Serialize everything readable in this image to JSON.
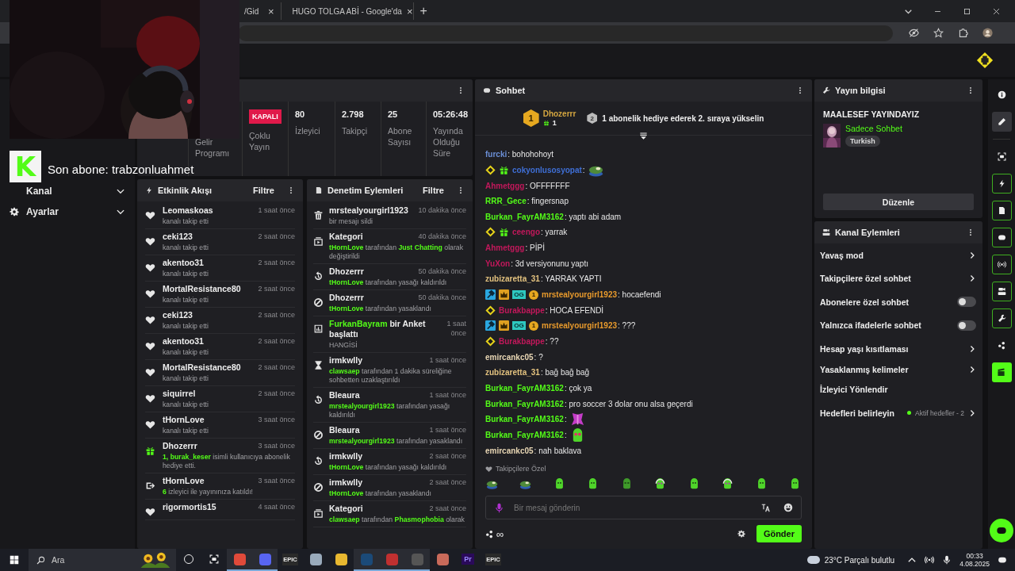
{
  "browser": {
    "tabs": [
      {
        "kind": "page",
        "label": "/Gid",
        "selected": false
      },
      {
        "kind": "search",
        "label": "HUGO TOLGA ABİ - Google'da",
        "selected": false
      }
    ],
    "close_glyph": "×",
    "new_tab_glyph": "+"
  },
  "webcam_overlay": {
    "kind": "picture",
    "logo_letter": "K",
    "text": "Son abone: trabzonluahmet"
  },
  "sidebar": {
    "items": [
      {
        "kind": "plain",
        "label": "Kanal",
        "expanded": false
      },
      {
        "kind": "settings",
        "label": "Ayarlar",
        "expanded": false
      }
    ]
  },
  "stats": [
    {
      "kind": "label",
      "label": "Gelir Programı"
    },
    {
      "kind": "badge",
      "value": "KAPALI",
      "label": "Çoklu Yayın"
    },
    {
      "kind": "number",
      "value": "80",
      "label": "İzleyici"
    },
    {
      "kind": "number",
      "value": "2.798",
      "label": "Takipçi"
    },
    {
      "kind": "number",
      "value": "25",
      "label": "Abone Sayısı"
    },
    {
      "kind": "number",
      "value": "05:26:48",
      "label": "Yayında Olduğu Süre"
    }
  ],
  "activity": {
    "title": "Etkinlik Akışı",
    "filter": "Filtre",
    "items": [
      {
        "kind": "follow",
        "user": "Leomaskoas",
        "time": "1 saat önce",
        "detail": [
          {
            "text": "kanalı takip etti",
            "accent": false
          }
        ]
      },
      {
        "kind": "follow",
        "user": "ceki123",
        "time": "2 saat önce",
        "detail": [
          {
            "text": "kanalı takip etti",
            "accent": false
          }
        ]
      },
      {
        "kind": "follow",
        "user": "akentoo31",
        "time": "2 saat önce",
        "detail": [
          {
            "text": "kanalı takip etti",
            "accent": false
          }
        ]
      },
      {
        "kind": "follow",
        "user": "MortalResistance80",
        "time": "2 saat önce",
        "detail": [
          {
            "text": "kanalı takip etti",
            "accent": false
          }
        ]
      },
      {
        "kind": "follow",
        "user": "ceki123",
        "time": "2 saat önce",
        "detail": [
          {
            "text": "kanalı takip etti",
            "accent": false
          }
        ]
      },
      {
        "kind": "follow",
        "user": "akentoo31",
        "time": "2 saat önce",
        "detail": [
          {
            "text": "kanalı takip etti",
            "accent": false
          }
        ]
      },
      {
        "kind": "follow",
        "user": "MortalResistance80",
        "time": "2 saat önce",
        "detail": [
          {
            "text": "kanalı takip etti",
            "accent": false
          }
        ]
      },
      {
        "kind": "follow",
        "user": "siquirrel",
        "time": "2 saat önce",
        "detail": [
          {
            "text": "kanalı takip etti",
            "accent": false
          }
        ]
      },
      {
        "kind": "follow",
        "user": "tHornLove",
        "time": "3 saat önce",
        "detail": [
          {
            "text": "kanalı takip etti",
            "accent": false
          }
        ]
      },
      {
        "kind": "gift",
        "user": "Dhozerrr",
        "time": "3 saat önce",
        "detail": [
          {
            "text": "1, burak_keser",
            "accent": true
          },
          {
            "text": " isimli kullanıcıya abonelik hediye etti.",
            "accent": false
          }
        ]
      },
      {
        "kind": "raid",
        "user": "tHornLove",
        "time": "3 saat önce",
        "detail": [
          {
            "text": "6",
            "accent": true
          },
          {
            "text": " izleyici ile yayınınıza katıldı!",
            "accent": false
          }
        ]
      },
      {
        "kind": "follow",
        "user": "rigormortis15",
        "time": "4 saat önce"
      }
    ]
  },
  "moderation": {
    "title": "Denetim Eylemleri",
    "filter": "Filtre",
    "items": [
      {
        "kind": "delete",
        "title": [
          {
            "text": "mrstealyourgirl1923",
            "accent": false
          }
        ],
        "time": "10 dakika önce",
        "detail": [
          {
            "text": "bir mesajı sildi",
            "accent": false
          }
        ]
      },
      {
        "kind": "category",
        "title": [
          {
            "text": "Kategori",
            "accent": false
          }
        ],
        "time": "40 dakika önce",
        "detail": [
          {
            "text": "tHornLove",
            "accent": true
          },
          {
            "text": " tarafından ",
            "accent": false
          },
          {
            "text": "Just Chatting",
            "accent": true
          },
          {
            "text": " olarak değiştirildi",
            "accent": false
          }
        ]
      },
      {
        "kind": "unban",
        "title": [
          {
            "text": "Dhozerrr",
            "accent": false
          }
        ],
        "time": "50 dakika önce",
        "detail": [
          {
            "text": "tHornLove",
            "accent": true
          },
          {
            "text": " tarafından yasağı kaldırıldı",
            "accent": false
          }
        ]
      },
      {
        "kind": "ban",
        "title": [
          {
            "text": "Dhozerrr",
            "accent": false
          }
        ],
        "time": "50 dakika önce",
        "detail": [
          {
            "text": "tHornLove",
            "accent": true
          },
          {
            "text": " tarafından yasaklandı",
            "accent": false
          }
        ]
      },
      {
        "kind": "poll",
        "title": [
          {
            "text": "FurkanBayram",
            "accent": true
          },
          {
            "text": " bir Anket başlattı",
            "accent": false
          }
        ],
        "time": "1 saat önce",
        "detail": [
          {
            "text": "HANGİSİ",
            "accent": false
          }
        ]
      },
      {
        "kind": "timeout",
        "title": [
          {
            "text": "irmkwlly",
            "accent": false
          }
        ],
        "time": "1 saat önce",
        "detail": [
          {
            "text": "clawsaep",
            "accent": true
          },
          {
            "text": " tarafından 1 dakika süreliğine sohbetten uzaklaştırıldı",
            "accent": false
          }
        ]
      },
      {
        "kind": "unban",
        "title": [
          {
            "text": "Bleaura",
            "accent": false
          }
        ],
        "time": "1 saat önce",
        "detail": [
          {
            "text": "mrstealyourgirl1923",
            "accent": true
          },
          {
            "text": " tarafından yasağı kaldırıldı",
            "accent": false
          }
        ]
      },
      {
        "kind": "ban",
        "title": [
          {
            "text": "Bleaura",
            "accent": false
          }
        ],
        "time": "1 saat önce",
        "detail": [
          {
            "text": "mrstealyourgirl1923",
            "accent": true
          },
          {
            "text": " tarafından yasaklandı",
            "accent": false
          }
        ]
      },
      {
        "kind": "unban",
        "title": [
          {
            "text": "irmkwlly",
            "accent": false
          }
        ],
        "time": "2 saat önce",
        "detail": [
          {
            "text": "tHornLove",
            "accent": true
          },
          {
            "text": " tarafından yasağı kaldırıldı",
            "accent": false
          }
        ]
      },
      {
        "kind": "ban",
        "title": [
          {
            "text": "irmkwlly",
            "accent": false
          }
        ],
        "time": "2 saat önce",
        "detail": [
          {
            "text": "tHornLove",
            "accent": true
          },
          {
            "text": " tarafından yasaklandı",
            "accent": false
          }
        ]
      },
      {
        "kind": "category",
        "title": [
          {
            "text": "Kategori",
            "accent": false
          }
        ],
        "time": "2 saat önce",
        "detail": [
          {
            "text": "clawsaep",
            "accent": true
          },
          {
            "text": " tarafından ",
            "accent": false
          },
          {
            "text": "Phasmophobia",
            "accent": true
          },
          {
            "text": " olarak",
            "accent": false
          }
        ]
      }
    ]
  },
  "chat": {
    "title": "Sohbet",
    "pinned": {
      "rank": "1",
      "user": "Dhozerrr",
      "gifts": "1",
      "next_rank": "2",
      "message": "1 abonelik hediye ederek 2. sıraya yükselin"
    },
    "messages": [
      {
        "user": "furcki",
        "color": "#6b8fd6",
        "text": ": bohohohoyt"
      },
      {
        "user": "cokyonlusosyopat",
        "color": "#3f6fd6",
        "badges": [
          {
            "kind": "diamond"
          },
          {
            "kind": "gift"
          }
        ],
        "text": ":",
        "emote": {
          "kind": "frog"
        }
      },
      {
        "user": "Ahmetggg",
        "color": "#c2185b",
        "text": ": OFFFFFFF"
      },
      {
        "user": "RRR_Gece",
        "color": "#53fc18",
        "text": ": fingersnap"
      },
      {
        "user": "Burkan_FayrAM3162",
        "color": "#53fc18",
        "text": ": yaptı abi adam"
      },
      {
        "user": "ceengo",
        "color": "#c2185b",
        "badges": [
          {
            "kind": "diamond"
          },
          {
            "kind": "gift"
          }
        ],
        "text": ": yarrak"
      },
      {
        "user": "Ahmetggg",
        "color": "#c2185b",
        "text": ": PİPİ"
      },
      {
        "user": "YuXon",
        "color": "#c2185b",
        "text": ": 3d versiyonunu yaptı"
      },
      {
        "user": "zubizaretta_31",
        "color": "#e3c27f",
        "text": ": YARRAK YAPTI"
      },
      {
        "user": "mrstealyourgirl1923",
        "color": "#e89a2c",
        "badges": [
          {
            "kind": "hammer"
          },
          {
            "kind": "crown"
          },
          {
            "kind": "og",
            "label": "OG"
          },
          {
            "kind": "coin",
            "label": "1"
          }
        ],
        "text": ": hocaefendi"
      },
      {
        "user": "Burakbappe",
        "color": "#c2185b",
        "badges": [
          {
            "kind": "diamond"
          }
        ],
        "text": ": HOCA EFENDİ"
      },
      {
        "user": "mrstealyourgirl1923",
        "color": "#e89a2c",
        "badges": [
          {
            "kind": "hammer"
          },
          {
            "kind": "crown"
          },
          {
            "kind": "og",
            "label": "OG"
          },
          {
            "kind": "coin",
            "label": "1"
          }
        ],
        "text": ": ???"
      },
      {
        "user": "Burakbappe",
        "color": "#c2185b",
        "badges": [
          {
            "kind": "diamond"
          }
        ],
        "text": ": ??"
      },
      {
        "user": "emircankc05",
        "color": "#e8d6b4",
        "text": ": ?"
      },
      {
        "user": "zubizaretta_31",
        "color": "#e3c27f",
        "text": ": bağ bağ bağ"
      },
      {
        "user": "Burkan_FayrAM3162",
        "color": "#53fc18",
        "text": ": çok ya"
      },
      {
        "user": "Burkan_FayrAM3162",
        "color": "#53fc18",
        "text": ": pro soccer 3 dolar onu alsa geçerdi"
      },
      {
        "user": "Burkan_FayrAM3162",
        "color": "#53fc18",
        "text": ":",
        "emote": {
          "kind": "butterfly"
        }
      },
      {
        "user": "Burkan_FayrAM3162",
        "color": "#53fc18",
        "text": ":",
        "emote": {
          "kind": "blob-hearts"
        }
      },
      {
        "user": "emircankc05",
        "color": "#e8d6b4",
        "text": ": nah baklava"
      }
    ],
    "emote_label": "Takipçilere Özel",
    "emotes": [
      {
        "kind": "frog"
      },
      {
        "kind": "frog"
      },
      {
        "kind": "blob"
      },
      {
        "kind": "blob"
      },
      {
        "kind": "blob-angry"
      },
      {
        "kind": "blob-headphones"
      },
      {
        "kind": "blob"
      },
      {
        "kind": "blob-headphones"
      },
      {
        "kind": "blob"
      },
      {
        "kind": "blob"
      }
    ],
    "input": {
      "placeholder": "Bir mesaj gönderin"
    },
    "extra": "∞",
    "send": "Gönder"
  },
  "stream_info": {
    "title": "Yayın bilgisi",
    "stream_title": "MAALESEF YAYINDAYIZ",
    "category": "Sadece Sohbet",
    "tag": "Turkish",
    "edit": "Düzenle"
  },
  "channel_actions": {
    "title": "Kanal Eylemleri",
    "items": [
      {
        "kind": "link",
        "label": "Yavaş mod"
      },
      {
        "kind": "link",
        "label": "Takipçilere özel sohbet"
      },
      {
        "kind": "toggle",
        "label": "Abonelere özel sohbet",
        "on": false
      },
      {
        "kind": "toggle",
        "label": "Yalnızca ifadelerle sohbet",
        "on": false
      },
      {
        "kind": "link",
        "label": "Hesap yaşı kısıtlaması"
      },
      {
        "kind": "link",
        "label": "Yasaklanmış kelimeler"
      },
      {
        "kind": "plain",
        "label": "İzleyici Yönlendir"
      },
      {
        "kind": "goal",
        "label": "Hedefleri belirleyin",
        "status": "Aktif hedefler - 2"
      }
    ]
  },
  "rail": [
    {
      "kind": "info",
      "selected": false,
      "on": false,
      "highlighted": false
    },
    {
      "kind": "pencil",
      "selected": true,
      "on": false,
      "highlighted": false
    },
    {
      "kind": "capture",
      "selected": false,
      "on": false,
      "highlighted": false
    },
    {
      "kind": "bolt",
      "selected": false,
      "on": true,
      "highlighted": false
    },
    {
      "kind": "doc",
      "selected": false,
      "on": true,
      "highlighted": false
    },
    {
      "kind": "chat",
      "selected": false,
      "on": true,
      "highlighted": false
    },
    {
      "kind": "broadcast",
      "selected": false,
      "on": true,
      "highlighted": false
    },
    {
      "kind": "channel",
      "selected": false,
      "on": true,
      "highlighted": false
    },
    {
      "kind": "wrench",
      "selected": false,
      "on": true,
      "highlighted": false
    },
    {
      "kind": "dots",
      "selected": false,
      "on": false,
      "highlighted": false
    },
    {
      "kind": "clapper",
      "selected": false,
      "on": false,
      "highlighted": true
    }
  ],
  "taskbar": {
    "search": "Ara",
    "apps": [
      {
        "kind": "cortana",
        "running": false
      },
      {
        "kind": "taskview",
        "running": false
      },
      {
        "kind": "chrome",
        "running": true
      },
      {
        "kind": "discord",
        "running": true
      },
      {
        "kind": "epic",
        "label": "EPIC",
        "running": false
      },
      {
        "kind": "paint",
        "running": false
      },
      {
        "kind": "folder",
        "running": false
      },
      {
        "kind": "steam",
        "running": true
      },
      {
        "kind": "obs",
        "running": true
      },
      {
        "kind": "calc",
        "running": true
      },
      {
        "kind": "ship",
        "running": false
      },
      {
        "kind": "premiere",
        "label": "Pr",
        "running": false
      },
      {
        "kind": "epic",
        "label": "EPIC",
        "running": false
      }
    ],
    "weather": "23°C Parçalı bulutlu",
    "time": "00:33",
    "date": "4.08.2025"
  }
}
